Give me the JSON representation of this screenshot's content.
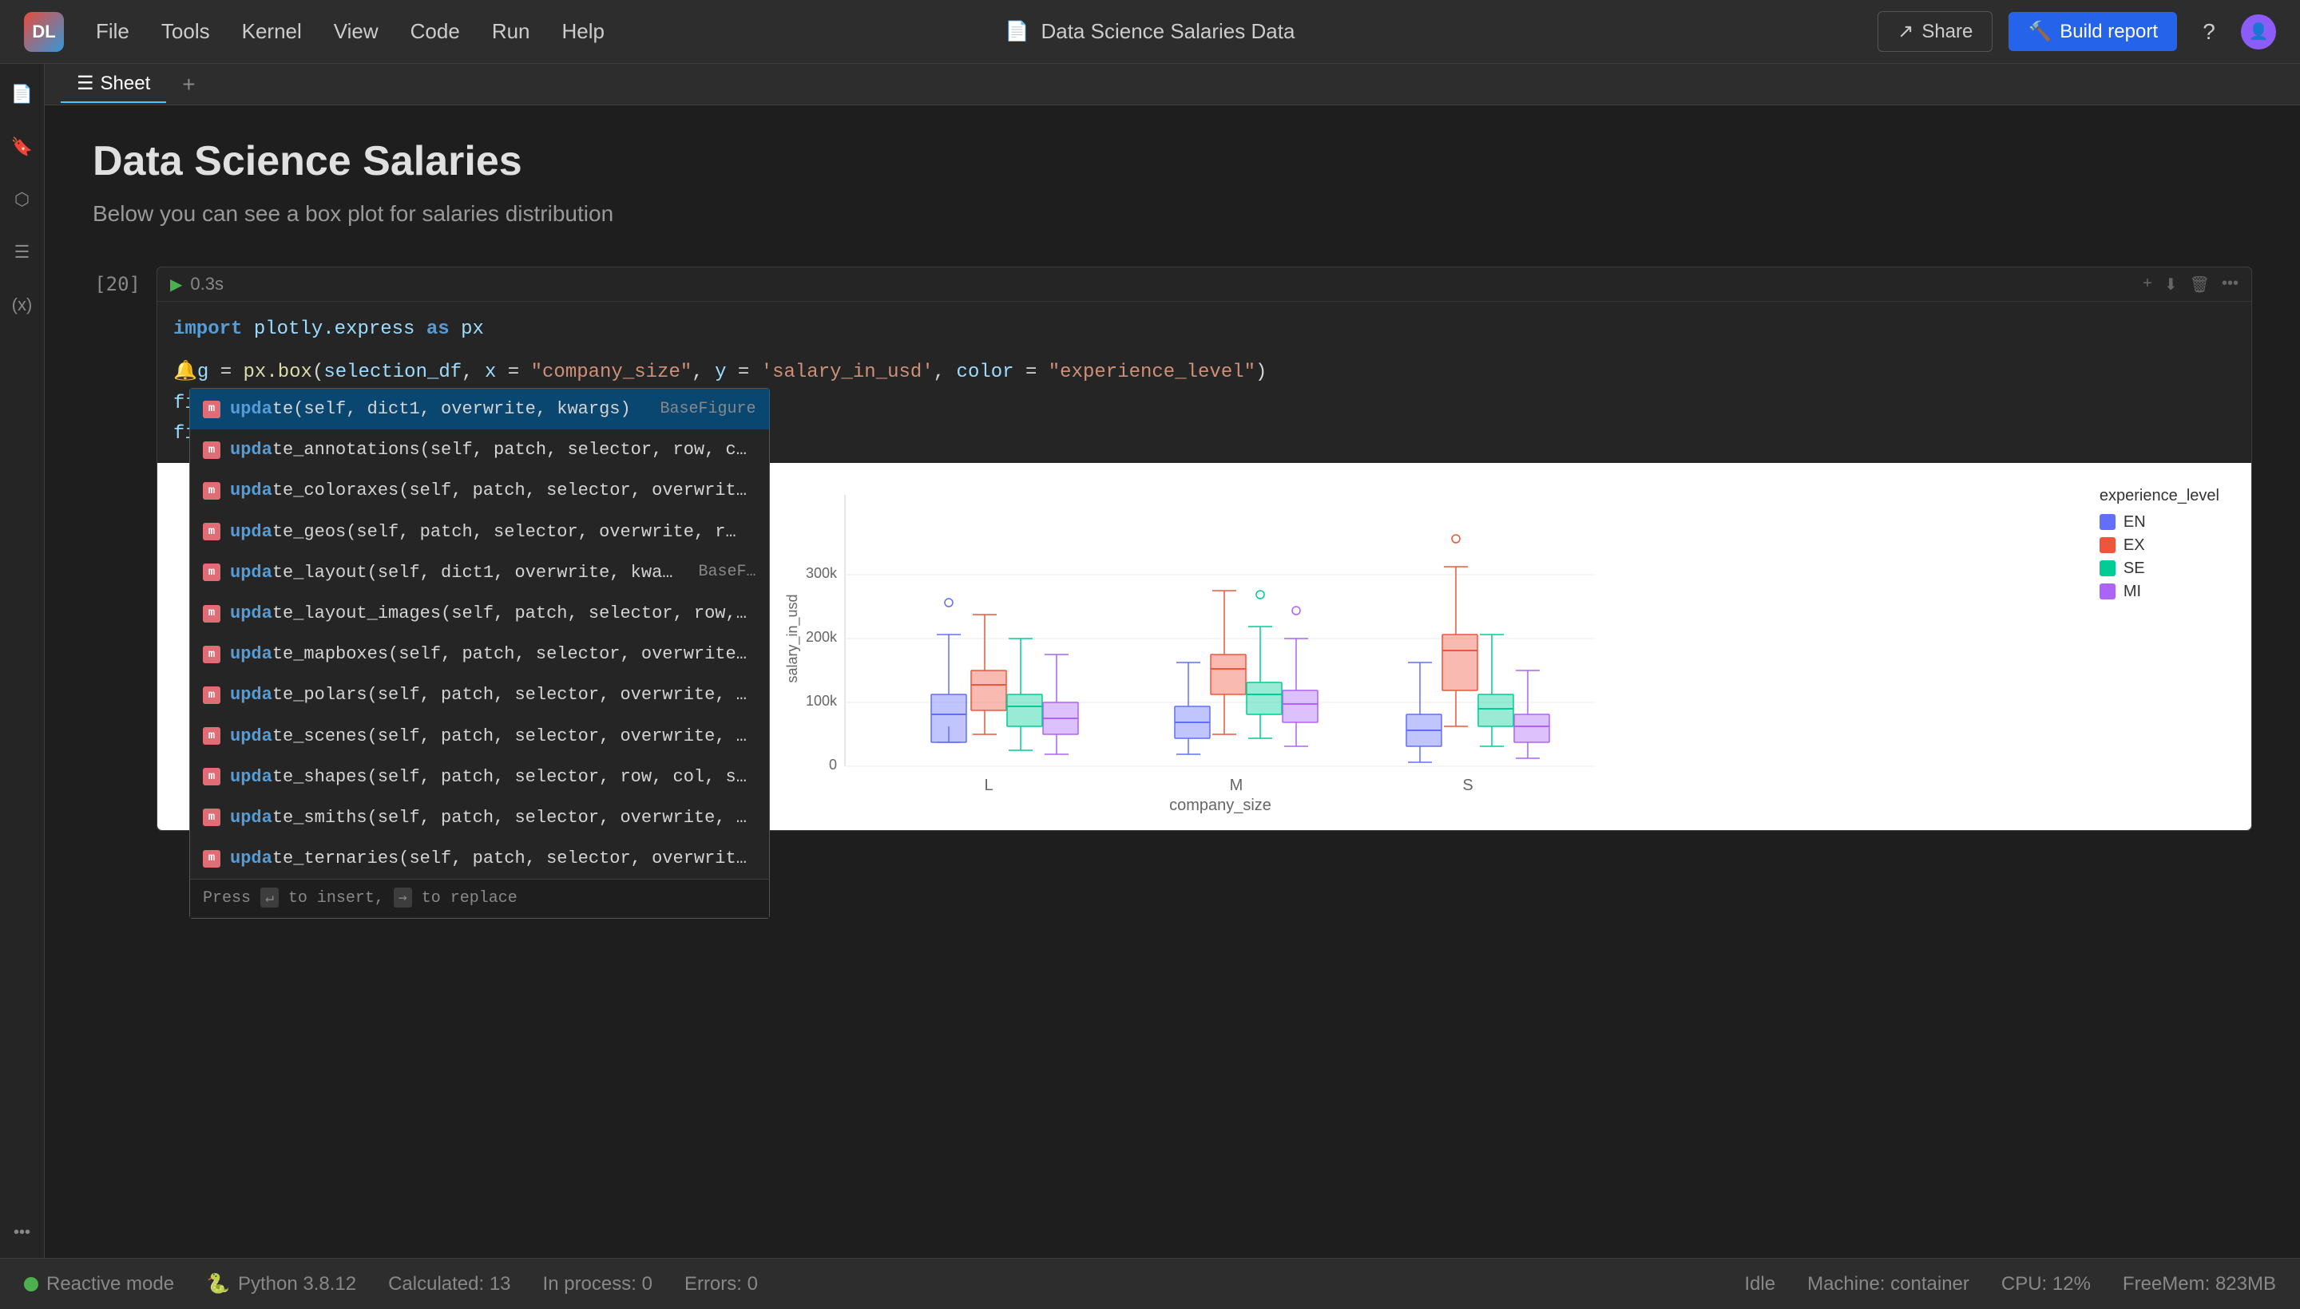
{
  "app": {
    "logo_text": "DL",
    "title": "Data Science Salaries Data",
    "title_icon": "📄"
  },
  "topbar": {
    "menu_items": [
      "File",
      "Tools",
      "Kernel",
      "View",
      "Code",
      "Run",
      "Help"
    ],
    "share_label": "Share",
    "build_label": "Build report",
    "help_icon": "?",
    "share_icon": "↗"
  },
  "notebook": {
    "page_title": "Data Science Salaries",
    "page_subtitle": "Below you can see a box plot for salaries distribution",
    "cell_number": "[20]",
    "run_time": "0.3s",
    "code_lines": {
      "line1_pre": "import",
      "line1_mod": "plotly.express",
      "line1_post": "as px",
      "line2_var": "g",
      "line2_code": " = px.box(selection_df, x = ",
      "line2_x": "\"company_size\"",
      "line2_mid": ", y = ",
      "line2_y": "'salary_in_usd'",
      "line2_mid2": ", color = ",
      "line2_color": "\"experience_level\"",
      "line2_end": ")",
      "line3": "fig.upda",
      "line4": "fig.show"
    }
  },
  "autocomplete": {
    "items": [
      {
        "icon": "m",
        "text_pre": "upda",
        "text_bold": "te",
        "text_post": "(self, dict1, overwrite, kwargs)",
        "type": "BaseFigure"
      },
      {
        "icon": "m",
        "text_pre": "upda",
        "text_bold": "te_annotations",
        "text_post": "(self, patch, selector, row, c…",
        "type": ""
      },
      {
        "icon": "m",
        "text_pre": "upda",
        "text_bold": "te_coloraxes",
        "text_post": "(self, patch, selector, overwrit…",
        "type": ""
      },
      {
        "icon": "m",
        "text_pre": "upda",
        "text_bold": "te_geos",
        "text_post": "(self, patch, selector, overwrite, r…",
        "type": ""
      },
      {
        "icon": "m",
        "text_pre": "upda",
        "text_bold": "te_layout",
        "text_post": "(self, dict1, overwrite, kwa…",
        "type": "BaseF…"
      },
      {
        "icon": "m",
        "text_pre": "upda",
        "text_bold": "te_layout_images",
        "text_post": "(self, patch, selector, row,…",
        "type": ""
      },
      {
        "icon": "m",
        "text_pre": "upda",
        "text_bold": "te_mapboxes",
        "text_post": "(self, patch, selector, overwrite…",
        "type": ""
      },
      {
        "icon": "m",
        "text_pre": "upda",
        "text_bold": "te_polars",
        "text_post": "(self, patch, selector, overwrite, …",
        "type": ""
      },
      {
        "icon": "m",
        "text_pre": "upda",
        "text_bold": "te_scenes",
        "text_post": "(self, patch, selector, overwrite, …",
        "type": ""
      },
      {
        "icon": "m",
        "text_pre": "upda",
        "text_bold": "te_shapes",
        "text_post": "(self, patch, selector, row, col, s…",
        "type": ""
      },
      {
        "icon": "m",
        "text_pre": "upda",
        "text_bold": "te_smiths",
        "text_post": "(self, patch, selector, overwrite, …",
        "type": ""
      },
      {
        "icon": "m",
        "text_pre": "upda",
        "text_bold": "te_ternaries",
        "text_post": "(self, patch, selector, overwrit…",
        "type": ""
      }
    ],
    "hint": "Press ↵ to insert, → to replace"
  },
  "chart": {
    "x_label": "company_size",
    "y_label": "salary_in_usd",
    "x_ticks": [
      "L",
      "M",
      "S"
    ],
    "y_ticks": [
      "0",
      "100k",
      "200k",
      "300k"
    ],
    "legend_title": "experience_level",
    "legend_items": [
      {
        "label": "EN",
        "color": "#636efa"
      },
      {
        "label": "EX",
        "color": "#ef553b"
      },
      {
        "label": "SE",
        "color": "#00cc96"
      },
      {
        "label": "MI",
        "color": "#ab63fa"
      }
    ]
  },
  "tabbar": {
    "active_tab": "Sheet",
    "add_icon": "+"
  },
  "statusbar": {
    "reactive_mode": "Reactive mode",
    "kernel": "Python 3.8.12",
    "calculated": "Calculated: 13",
    "in_process": "In process: 0",
    "errors": "Errors: 0",
    "status_right": "Idle",
    "machine": "Machine: container",
    "cpu": "CPU: 12%",
    "free_mem": "FreeMem:",
    "free_mem_val": "823MB"
  },
  "sidebar": {
    "icons": [
      "📄",
      "🔖",
      "⬡",
      "☰",
      "(x)"
    ]
  }
}
